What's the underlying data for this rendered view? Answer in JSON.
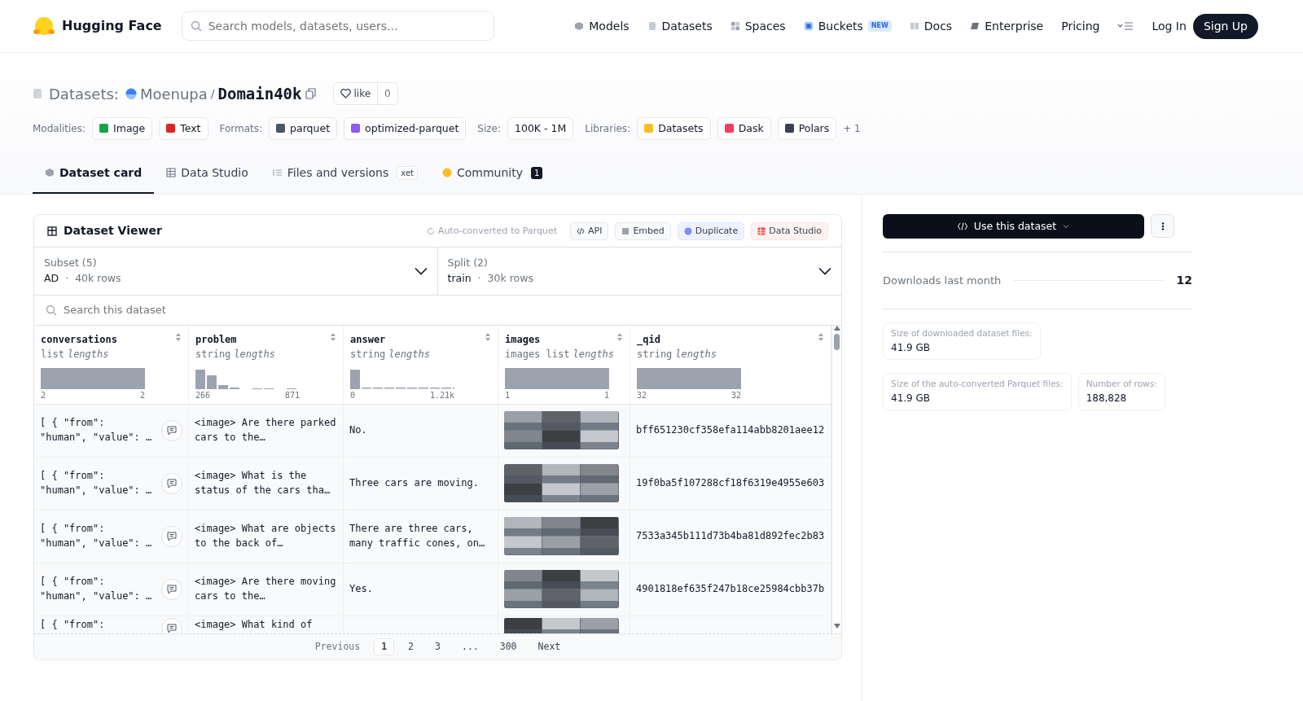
{
  "nav": {
    "brand": "Hugging Face",
    "search_placeholder": "Search models, datasets, users...",
    "links": [
      {
        "label": "Models"
      },
      {
        "label": "Datasets"
      },
      {
        "label": "Spaces"
      },
      {
        "label": "Buckets",
        "badge": "NEW"
      },
      {
        "label": "Docs"
      },
      {
        "label": "Enterprise"
      },
      {
        "label": "Pricing"
      }
    ],
    "login": "Log In",
    "signup": "Sign Up"
  },
  "header": {
    "section": "Datasets:",
    "owner": "Moenupa",
    "separator": "/",
    "name": "Domain40k",
    "like_label": "like",
    "like_count": "0",
    "tag_groups": [
      {
        "label": "Modalities:",
        "tags": [
          {
            "text": "Image",
            "color": "#16a34a"
          },
          {
            "text": "Text",
            "color": "#dc2626"
          }
        ]
      },
      {
        "label": "Formats:",
        "tags": [
          {
            "text": "parquet",
            "color": "#4b5563"
          },
          {
            "text": "optimized-parquet",
            "color": "#8b5cf6"
          }
        ]
      },
      {
        "label": "Size:",
        "tags": [
          {
            "text": "100K - 1M"
          }
        ]
      },
      {
        "label": "Libraries:",
        "tags": [
          {
            "text": "Datasets",
            "color": "#fbbf24"
          },
          {
            "text": "Dask",
            "color": "#f43f5e"
          },
          {
            "text": "Polars",
            "color": "#374151"
          }
        ],
        "more": "+ 1"
      }
    ]
  },
  "tabs": [
    {
      "label": "Dataset card",
      "selected": true
    },
    {
      "label": "Data Studio",
      "selected": false
    },
    {
      "label": "Files and versions",
      "selected": false,
      "badge": "xet"
    },
    {
      "label": "Community",
      "selected": false,
      "count": "1"
    }
  ],
  "viewer": {
    "title": "Dataset Viewer",
    "converted_link": "Auto-converted",
    "converted_rest": "to Parquet",
    "buttons": [
      {
        "label": "API"
      },
      {
        "label": "Embed"
      },
      {
        "label": "Duplicate"
      },
      {
        "label": "Data Studio"
      }
    ],
    "subset": {
      "label": "Subset (5)",
      "value": "AD",
      "separator": "·",
      "rows": "40k rows"
    },
    "split": {
      "label": "Split (2)",
      "value": "train",
      "separator": "·",
      "rows": "30k rows"
    },
    "search_placeholder": "Search this dataset",
    "columns": [
      {
        "name": "conversations",
        "type": "list",
        "note": "lengths",
        "kind": "uniform",
        "min": "2",
        "max": "2"
      },
      {
        "name": "problem",
        "type": "string",
        "note": "lengths",
        "kind": "skewed",
        "min": "266",
        "max": "871"
      },
      {
        "name": "answer",
        "type": "string",
        "note": "lengths",
        "kind": "spike",
        "min": "0",
        "max": "1.21k"
      },
      {
        "name": "images",
        "type": "images list",
        "note": "lengths",
        "kind": "uniform",
        "min": "1",
        "max": "1"
      },
      {
        "name": "_qid",
        "type": "string",
        "note": "lengths",
        "kind": "uniform",
        "min": "32",
        "max": "32"
      }
    ],
    "rows": [
      {
        "conversations": "[ { \"from\": \"human\", \"value\": …",
        "problem": "<image> Are there parked cars to the…",
        "answer": "No.",
        "qid": "bff651230cf358efa114abb8201aee12"
      },
      {
        "conversations": "[ { \"from\": \"human\", \"value\": …",
        "problem": "<image> What is the status of the cars tha…",
        "answer": "Three cars are moving.",
        "qid": "19f0ba5f107288cf18f6319e4955e603"
      },
      {
        "conversations": "[ { \"from\": \"human\", \"value\": …",
        "problem": "<image> What are objects to the back of…",
        "answer": "There are three cars, many traffic cones, on…",
        "qid": "7533a345b111d73b4ba81d892fec2b83"
      },
      {
        "conversations": "[ { \"from\": \"human\", \"value\": …",
        "problem": "<image> Are there moving cars to the…",
        "answer": "Yes.",
        "qid": "4901818ef635f247b18ce25984cbb37b"
      },
      {
        "conversations": "[ { \"from\":",
        "problem": "<image> What kind of"
      }
    ],
    "pagination": {
      "previous": "Previous",
      "next": "Next",
      "pages": [
        {
          "label": "1",
          "selected": true
        },
        {
          "label": "2",
          "selected": false
        },
        {
          "label": "3",
          "selected": false
        },
        {
          "label": "...",
          "selected": false
        },
        {
          "label": "300",
          "selected": false
        }
      ]
    }
  },
  "sidebar": {
    "use_button": "Use this dataset",
    "downloads_label": "Downloads last month",
    "downloads": "12",
    "stats": [
      {
        "label": "Size of downloaded dataset files:",
        "value": "41.9 GB"
      },
      {
        "label": "Size of the auto-converted Parquet files:",
        "value": "41.9 GB"
      },
      {
        "label": "Number of rows:",
        "value": "188,828"
      }
    ]
  }
}
